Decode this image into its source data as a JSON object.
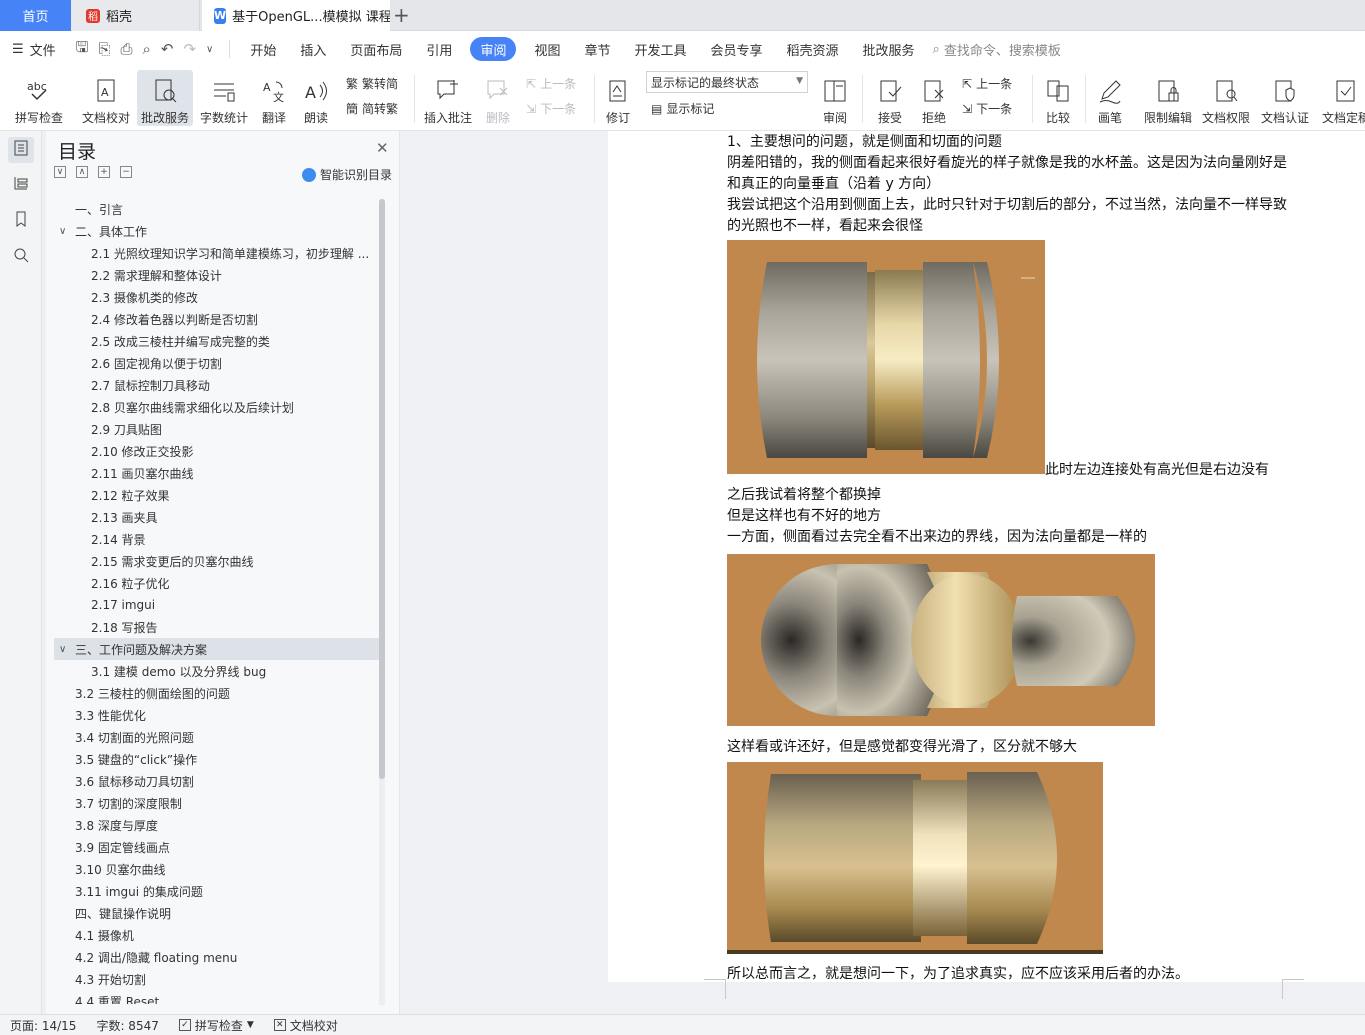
{
  "tabs": {
    "home": "首页",
    "daoke": "稻壳",
    "document": "基于OpenGL...模模拟 课程论",
    "new_tab": "+"
  },
  "menubar": {
    "file": "文件",
    "items": [
      "开始",
      "插入",
      "页面布局",
      "引用",
      "审阅",
      "视图",
      "章节",
      "开发工具",
      "会员专享",
      "稻壳资源",
      "批改服务"
    ],
    "active": "审阅",
    "search": "查找命令、搜索模板"
  },
  "ribbon": {
    "spell_check": "拼写检查",
    "doc_proof": "文档校对",
    "correction_service": "批改服务",
    "word_count": "字数统计",
    "translate": "翻译",
    "read_aloud": "朗读",
    "trad_to_simp": "繁转简",
    "simp_to_trad": "简转繁",
    "insert_comment": "插入批注",
    "delete": "删除",
    "prev_comment": "上一条",
    "next_comment": "下一条",
    "revise": "修订",
    "markup_state": "显示标记的最终状态",
    "show_markup": "显示标记",
    "review": "审阅",
    "accept": "接受",
    "reject": "拒绝",
    "prev_change": "上一条",
    "next_change": "下一条",
    "compare": "比较",
    "ink": "画笔",
    "restrict_edit": "限制编辑",
    "doc_rights": "文档权限",
    "doc_cert": "文档认证",
    "doc_final": "文档定稿"
  },
  "toc": {
    "title": "目录",
    "smart": "智能识别目录",
    "items": [
      {
        "text": "一、引言",
        "level": 1,
        "chev": ""
      },
      {
        "text": "二、具体工作",
        "level": 1,
        "chev": "∨"
      },
      {
        "text": "2.1  光照纹理知识学习和简单建模练习，初步理解 ...",
        "level": 2,
        "chev": ""
      },
      {
        "text": "2.2  需求理解和整体设计",
        "level": 2,
        "chev": ""
      },
      {
        "text": "2.3  摄像机类的修改",
        "level": 2,
        "chev": ""
      },
      {
        "text": "2.4  修改着色器以判断是否切割",
        "level": 2,
        "chev": ""
      },
      {
        "text": "2.5  改成三棱柱并编写成完整的类",
        "level": 2,
        "chev": ""
      },
      {
        "text": "2.6  固定视角以便于切割",
        "level": 2,
        "chev": ""
      },
      {
        "text": "2.7  鼠标控制刀具移动",
        "level": 2,
        "chev": ""
      },
      {
        "text": "2.8  贝塞尔曲线需求细化以及后续计划",
        "level": 2,
        "chev": ""
      },
      {
        "text": "2.9  刀具贴图",
        "level": 2,
        "chev": ""
      },
      {
        "text": "2.10  修改正交投影",
        "level": 2,
        "chev": ""
      },
      {
        "text": "2.11  画贝塞尔曲线",
        "level": 2,
        "chev": ""
      },
      {
        "text": "2.12  粒子效果",
        "level": 2,
        "chev": ""
      },
      {
        "text": "2.13  画夹具",
        "level": 2,
        "chev": ""
      },
      {
        "text": "2.14  背景",
        "level": 2,
        "chev": ""
      },
      {
        "text": "2.15  需求变更后的贝塞尔曲线",
        "level": 2,
        "chev": ""
      },
      {
        "text": "2.16  粒子优化",
        "level": 2,
        "chev": ""
      },
      {
        "text": "2.17  imgui",
        "level": 2,
        "chev": ""
      },
      {
        "text": "2.18  写报告",
        "level": 2,
        "chev": ""
      },
      {
        "text": "三、工作问题及解决方案",
        "level": 1,
        "chev": "∨",
        "selected": true
      },
      {
        "text": "3.1  建模 demo 以及分界线 bug",
        "level": 2,
        "chev": ""
      },
      {
        "text": "3.2  三棱柱的侧面绘图的问题",
        "level": 1,
        "chev": ""
      },
      {
        "text": "3.3  性能优化",
        "level": 1,
        "chev": ""
      },
      {
        "text": "3.4  切割面的光照问题",
        "level": 1,
        "chev": ""
      },
      {
        "text": "3.5  键盘的“click”操作",
        "level": 1,
        "chev": ""
      },
      {
        "text": "3.6  鼠标移动刀具切割",
        "level": 1,
        "chev": ""
      },
      {
        "text": "3.7  切割的深度限制",
        "level": 1,
        "chev": ""
      },
      {
        "text": "3.8  深度与厚度",
        "level": 1,
        "chev": ""
      },
      {
        "text": "3.9  固定管线画点",
        "level": 1,
        "chev": ""
      },
      {
        "text": "3.10  贝塞尔曲线",
        "level": 1,
        "chev": ""
      },
      {
        "text": "3.11  imgui 的集成问题",
        "level": 1,
        "chev": ""
      },
      {
        "text": "四、键鼠操作说明",
        "level": 1,
        "chev": ""
      },
      {
        "text": "4.1  摄像机",
        "level": 1,
        "chev": ""
      },
      {
        "text": "4.2  调出/隐藏 floating menu",
        "level": 1,
        "chev": ""
      },
      {
        "text": "4.3  开始切割",
        "level": 1,
        "chev": ""
      },
      {
        "text": "4.4  重置 Reset",
        "level": 1,
        "chev": ""
      }
    ]
  },
  "document": {
    "p1": "1、主要想问的问题，就是侧面和切面的问题",
    "p2": "阴差阳错的，我的侧面看起来很好看旋光的样子就像是我的水杯盖。这是因为法向量刚好是",
    "p3": "和真正的向量垂直（沿着 y 方向）",
    "p4": "我尝试把这个沿用到侧面上去，此时只针对于切割后的部分，不过当然，法向量不一样导致",
    "p5": "的光照也不一样，看起来会很怪",
    "p6": "此时左边连接处有高光但是右边没有",
    "p7": "之后我试着将整个都换掉",
    "p8": "但是这样也有不好的地方",
    "p9": "一方面，侧面看过去完全看不出来边的界线，因为法向量都是一样的",
    "p10": "这样看或许还好，但是感觉都变得光滑了，区分就不够大",
    "p11": "所以总而言之，就是想问一下，为了追求真实，应不应该采用后者的办法。"
  },
  "status": {
    "page": "页面: 14/15",
    "words": "字数: 8547",
    "spell": "拼写检查",
    "proof": "文档校对"
  },
  "colors": {
    "accent": "#4583f7",
    "background_orange": "#c0884c"
  }
}
